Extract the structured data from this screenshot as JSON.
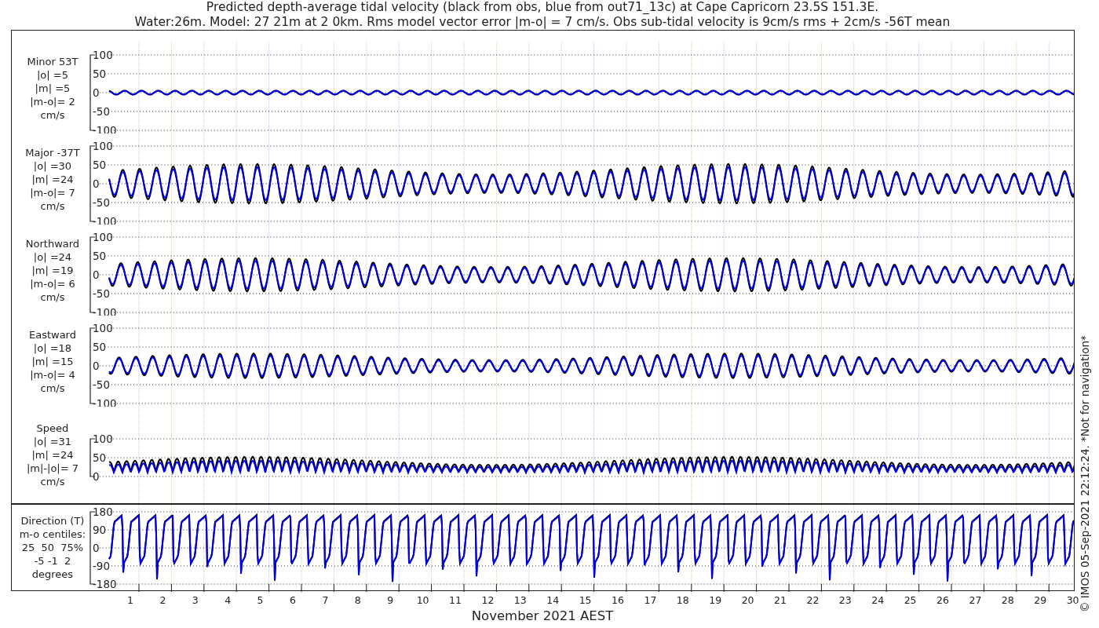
{
  "title": [
    "Predicted depth-average tidal velocity (black from obs, blue from out71_13c) at Cape Capricorn 23.5S 151.3E.",
    "Water:26m. Model: 27 21m at 2 0km. Rms model vector error |m-o| = 7 cm/s. Obs sub-tidal velocity is 9cm/s rms + 2cm/s -56T mean"
  ],
  "panels": [
    {
      "kind": "velocity",
      "label": [
        "Minor 53T",
        "|o| =5",
        "|m| =5",
        "|m-o|= 2",
        "cm/s"
      ],
      "yticks": [
        "100",
        "50",
        "0",
        "-50",
        "-100"
      ]
    },
    {
      "kind": "velocity",
      "label": [
        "Major -37T",
        "|o| =30",
        "|m| =24",
        "|m-o|= 7",
        "cm/s"
      ],
      "yticks": [
        "100",
        "50",
        "0",
        "-50",
        "-100"
      ]
    },
    {
      "kind": "velocity",
      "label": [
        "Northward",
        "|o| =24",
        "|m| =19",
        "|m-o|= 6",
        "cm/s"
      ],
      "yticks": [
        "100",
        "50",
        "0",
        "-50",
        "-100"
      ]
    },
    {
      "kind": "velocity",
      "label": [
        "Eastward",
        "|o| =18",
        "|m| =15",
        "|m-o|= 4",
        "cm/s"
      ],
      "yticks": [
        "100",
        "50",
        "0",
        "-50",
        "-100"
      ]
    },
    {
      "kind": "speed",
      "label": [
        "Speed",
        "|o| =31",
        "|m| =24",
        "|m|-|o|= 7",
        "cm/s"
      ],
      "yticks": [
        "100",
        "50",
        "0"
      ]
    },
    {
      "kind": "direction",
      "label": [
        "Direction (T)",
        "m-o centiles:",
        "25  50  75%",
        "-5 -1  2",
        "degrees"
      ],
      "yticks": [
        "180",
        "90",
        "0",
        "-90",
        "-180"
      ]
    }
  ],
  "x_axis": {
    "ticks": [
      "1",
      "2",
      "3",
      "4",
      "5",
      "6",
      "7",
      "8",
      "9",
      "10",
      "11",
      "12",
      "13",
      "14",
      "15",
      "16",
      "17",
      "18",
      "19",
      "20",
      "21",
      "22",
      "23",
      "24",
      "25",
      "26",
      "27",
      "28",
      "29",
      "30"
    ],
    "label": "November 2021 AEST"
  },
  "credit": "© IMOS 05-Sep-2021 22:12:24. *Not for navigation*"
}
